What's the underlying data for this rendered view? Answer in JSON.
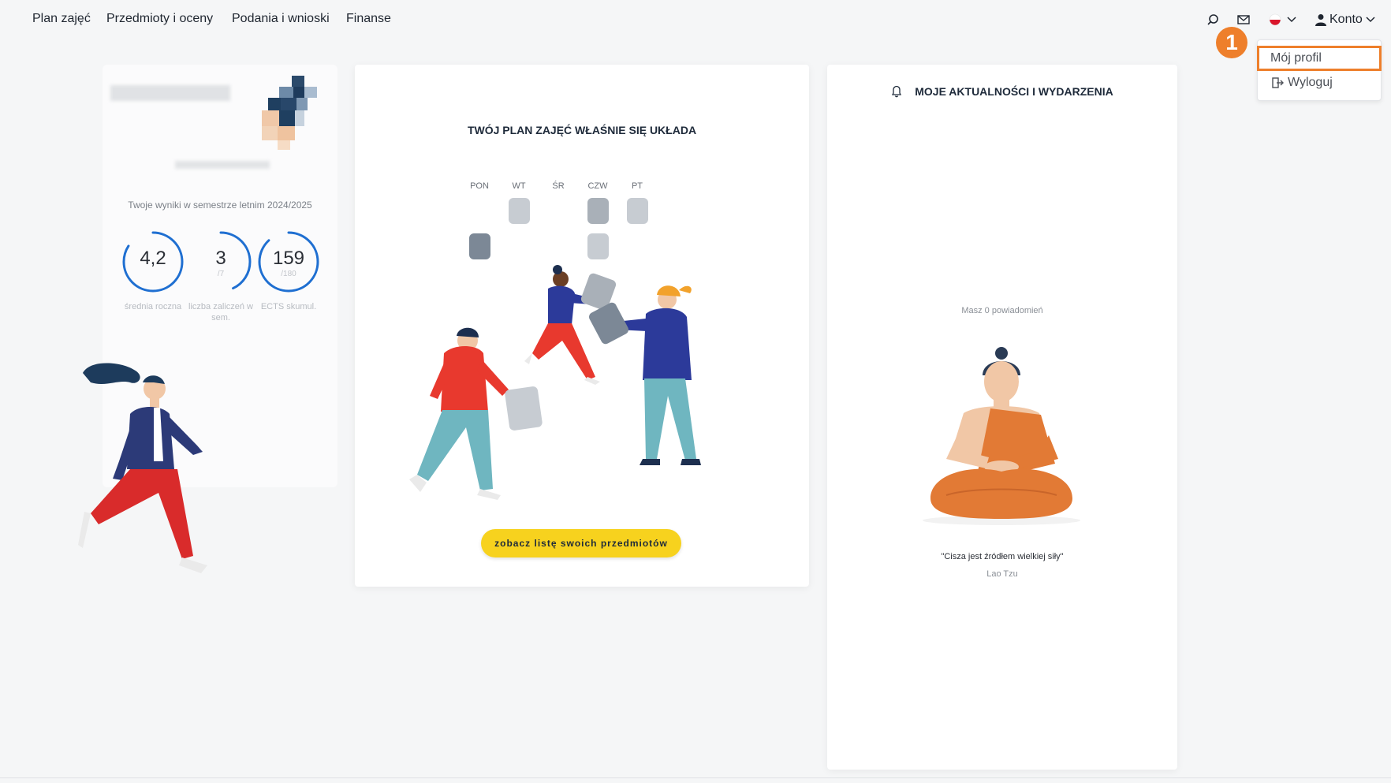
{
  "nav": {
    "items": [
      "Plan zajęć",
      "Przedmioty i oceny",
      "Podania i wnioski",
      "Finanse"
    ]
  },
  "header": {
    "search_icon": "search-icon",
    "mail_icon": "mail-icon",
    "language_flag": "poland-flag-icon",
    "account_label": "Konto"
  },
  "account_menu": {
    "profile_label": "Mój profil",
    "logout_label": "Wyloguj",
    "step_marker": "1"
  },
  "profile": {
    "results_title": "Twoje wyniki w semestrze letnim 2024/2025",
    "stats": [
      {
        "value": "4,2",
        "sub": "",
        "label": "średnia roczna",
        "progress": 0.84
      },
      {
        "value": "3",
        "sub": "/7",
        "label": "liczba zaliczeń w sem.",
        "progress": 0.43
      },
      {
        "value": "159",
        "sub": "/180",
        "label": "ECTS skumul.",
        "progress": 0.88
      }
    ]
  },
  "plan": {
    "title": "TWÓJ PLAN ZAJĘĆ WŁAŚNIE SIĘ UKŁADA",
    "days": [
      "PON",
      "WT",
      "ŚR",
      "CZW",
      "PT"
    ],
    "cta_label": "zobacz listę swoich przedmiotów"
  },
  "news": {
    "title": "MOJE AKTUALNOŚCI I WYDARZENIA",
    "empty_text": "Masz 0 powiadomień",
    "quote": "\"Cisza jest źródłem wielkiej siły\"",
    "quote_author": "Lao Tzu"
  },
  "colors": {
    "accent_orange": "#ee7f2b",
    "ring_blue": "#1f6fd1",
    "cta_yellow": "#f7d21e"
  }
}
